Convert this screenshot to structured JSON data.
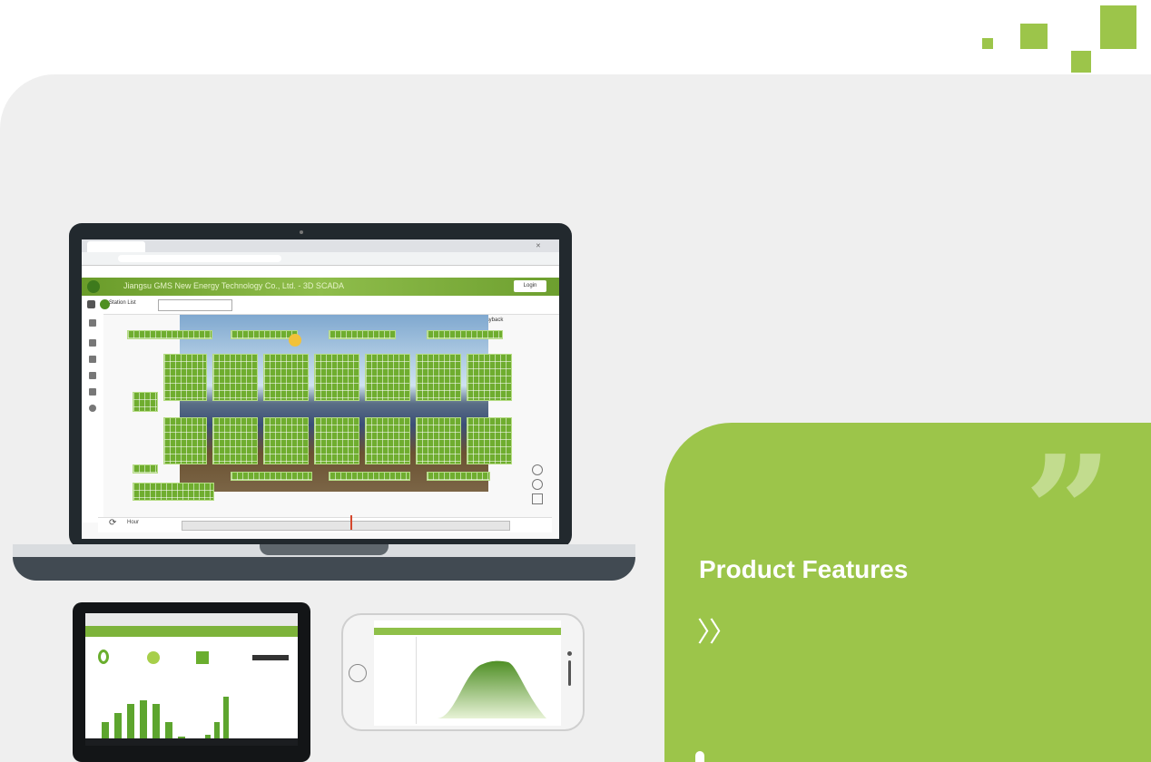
{
  "feature_card": {
    "title": "Product Features",
    "chevrons": "〉〉",
    "quote_mark": "”"
  },
  "laptop_app": {
    "window_title": "Jiangsu GMS New Energy Technology Co., Ltd. - 3D SCADA",
    "login_label": "Login",
    "station_list_label": "Station List",
    "search_placeholder": "",
    "browser_url": "",
    "timeline_zoom_label": "Hour",
    "control_label": "Playback"
  },
  "colors": {
    "brand_green": "#9cc54a",
    "panel_green": "#6fad2f",
    "background": "#efefef",
    "device_dark": "#22292e"
  },
  "decorations": {
    "corner_squares": 4
  }
}
